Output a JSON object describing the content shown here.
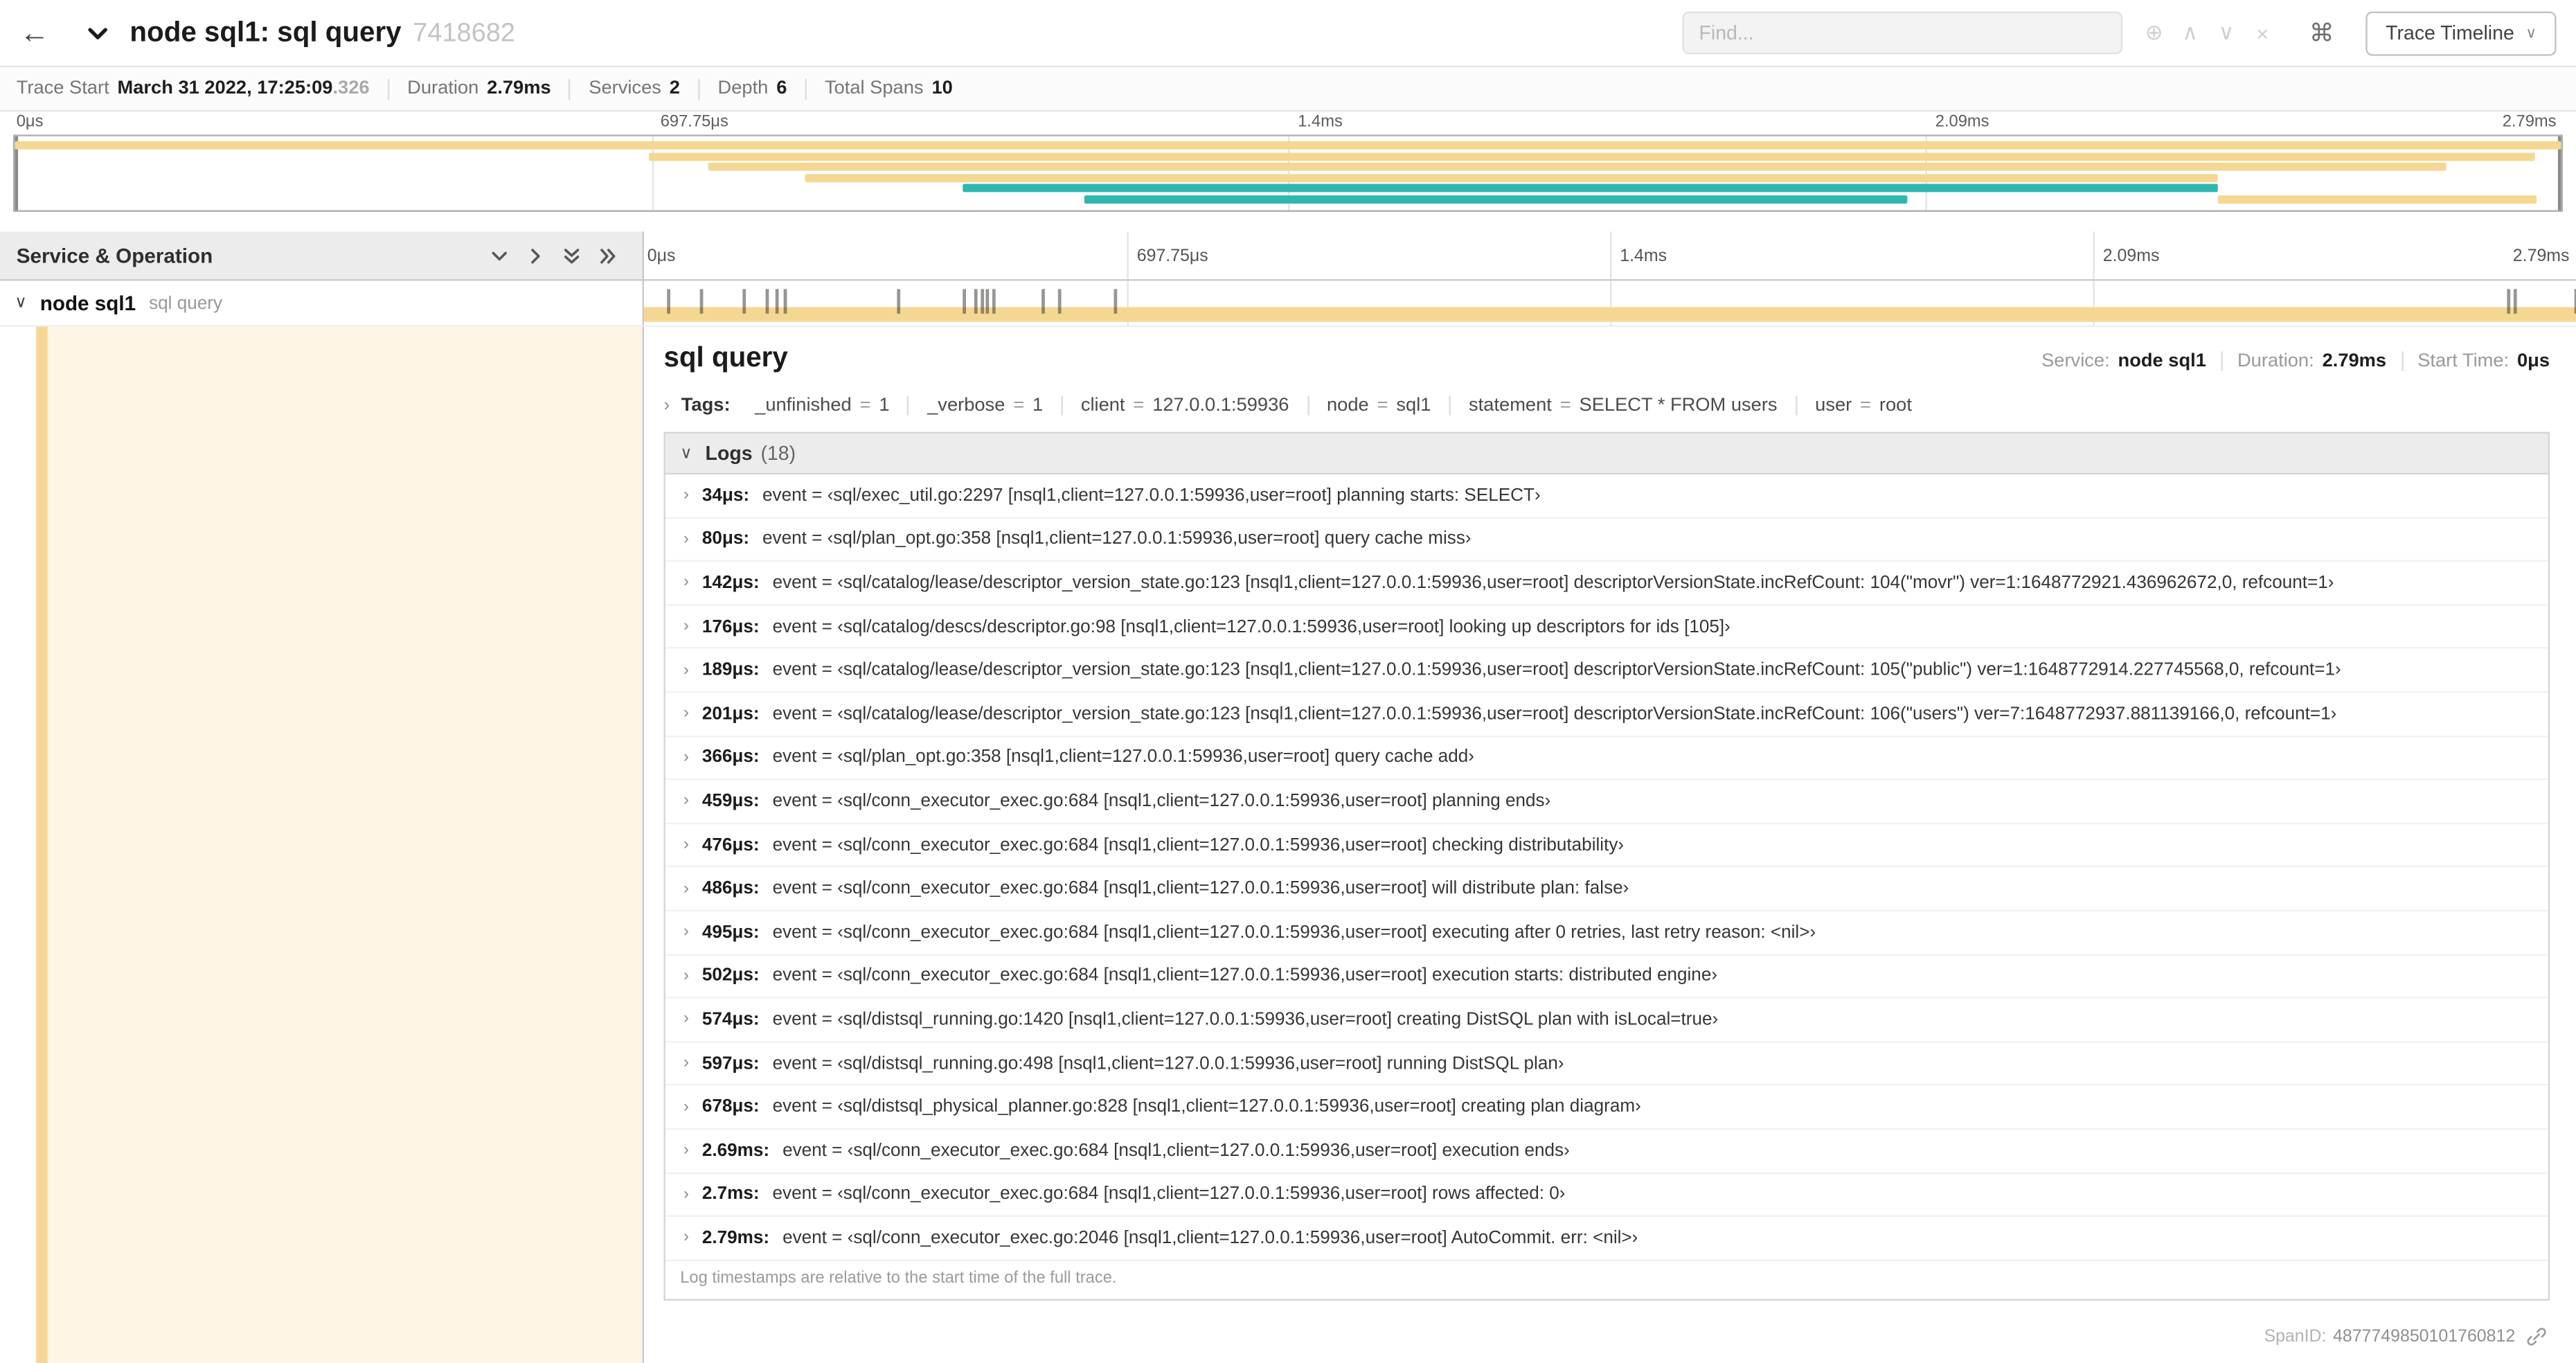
{
  "icons": {
    "back": "←",
    "chevron_down": "∨",
    "chevron_right": "›",
    "find_focus": "⊕",
    "find_prev": "∧",
    "find_next": "∨",
    "find_clear": "×",
    "command": "⌘"
  },
  "colors": {
    "span_tan": "#F5D794",
    "span_teal": "#2FB6B0",
    "detail_bg": "#FCF5E4"
  },
  "header": {
    "title": "node sql1: sql query",
    "trace_id": "7418682",
    "find_placeholder": "Find...",
    "view_menu_label": "Trace Timeline"
  },
  "trace_info": {
    "trace_start_label": "Trace Start",
    "trace_start_date": "March 31 2022, 17:25:09",
    "trace_start_frac": ".326",
    "duration_label": "Duration",
    "duration_value": "2.79ms",
    "services_label": "Services",
    "services_value": "2",
    "depth_label": "Depth",
    "depth_value": "6",
    "total_spans_label": "Total Spans",
    "total_spans_value": "10"
  },
  "minimap": {
    "ticks": [
      "0μs",
      "697.75μs",
      "1.4ms",
      "2.09ms",
      "2.79ms"
    ],
    "spans": [
      {
        "row": 0,
        "start": 0,
        "end": 100,
        "color": "tan"
      },
      {
        "row": 1,
        "start": 24.9,
        "end": 99,
        "color": "tan"
      },
      {
        "row": 2,
        "start": 27.2,
        "end": 95.5,
        "color": "tan"
      },
      {
        "row": 3,
        "start": 31,
        "end": 86.5,
        "color": "tan"
      },
      {
        "row": 4,
        "start": 37.2,
        "end": 86.5,
        "color": "teal"
      },
      {
        "row": 5,
        "start": 42,
        "end": 74.3,
        "color": "teal"
      },
      {
        "row": 5,
        "start": 86.5,
        "end": 99,
        "color": "tan"
      }
    ]
  },
  "timeline": {
    "left_header": "Service & Operation",
    "ticks": [
      "0μs",
      "697.75μs",
      "1.4ms",
      "2.09ms",
      "2.79ms"
    ]
  },
  "span_row": {
    "service": "node sql1",
    "operation": "sql query",
    "log_marker_pcts": [
      1.2,
      2.9,
      5.1,
      6.3,
      6.8,
      7.2,
      13.1,
      16.5,
      17.1,
      17.4,
      17.7,
      18.0,
      20.6,
      21.4,
      24.3,
      96.4,
      96.8,
      99.9
    ]
  },
  "detail": {
    "title": "sql query",
    "service_label": "Service:",
    "service_value": "node sql1",
    "duration_label": "Duration:",
    "duration_value": "2.79ms",
    "start_label": "Start Time:",
    "start_value": "0μs",
    "tags_label": "Tags:",
    "tag_separator": "=",
    "tags": [
      {
        "key": "_unfinished",
        "value": "1"
      },
      {
        "key": "_verbose",
        "value": "1"
      },
      {
        "key": "client",
        "value": "127.0.0.1:59936"
      },
      {
        "key": "node",
        "value": "sql1"
      },
      {
        "key": "statement",
        "value": "SELECT * FROM users"
      },
      {
        "key": "user",
        "value": "root"
      }
    ],
    "logs_label": "Logs",
    "logs_count_display": "(18)",
    "logs": [
      {
        "time": "34μs:",
        "message": "event = ‹sql/exec_util.go:2297 [nsql1,client=127.0.0.1:59936,user=root] planning starts: SELECT›"
      },
      {
        "time": "80μs:",
        "message": "event = ‹sql/plan_opt.go:358 [nsql1,client=127.0.0.1:59936,user=root] query cache miss›"
      },
      {
        "time": "142μs:",
        "message": "event = ‹sql/catalog/lease/descriptor_version_state.go:123 [nsql1,client=127.0.0.1:59936,user=root] descriptorVersionState.incRefCount: 104(\"movr\") ver=1:1648772921.436962672,0, refcount=1›"
      },
      {
        "time": "176μs:",
        "message": "event = ‹sql/catalog/descs/descriptor.go:98 [nsql1,client=127.0.0.1:59936,user=root] looking up descriptors for ids [105]›"
      },
      {
        "time": "189μs:",
        "message": "event = ‹sql/catalog/lease/descriptor_version_state.go:123 [nsql1,client=127.0.0.1:59936,user=root] descriptorVersionState.incRefCount: 105(\"public\") ver=1:1648772914.227745568,0, refcount=1›"
      },
      {
        "time": "201μs:",
        "message": "event = ‹sql/catalog/lease/descriptor_version_state.go:123 [nsql1,client=127.0.0.1:59936,user=root] descriptorVersionState.incRefCount: 106(\"users\") ver=7:1648772937.881139166,0, refcount=1›"
      },
      {
        "time": "366μs:",
        "message": "event = ‹sql/plan_opt.go:358 [nsql1,client=127.0.0.1:59936,user=root] query cache add›"
      },
      {
        "time": "459μs:",
        "message": "event = ‹sql/conn_executor_exec.go:684 [nsql1,client=127.0.0.1:59936,user=root] planning ends›"
      },
      {
        "time": "476μs:",
        "message": "event = ‹sql/conn_executor_exec.go:684 [nsql1,client=127.0.0.1:59936,user=root] checking distributability›"
      },
      {
        "time": "486μs:",
        "message": "event = ‹sql/conn_executor_exec.go:684 [nsql1,client=127.0.0.1:59936,user=root] will distribute plan: false›"
      },
      {
        "time": "495μs:",
        "message": "event = ‹sql/conn_executor_exec.go:684 [nsql1,client=127.0.0.1:59936,user=root] executing after 0 retries, last retry reason: <nil>›"
      },
      {
        "time": "502μs:",
        "message": "event = ‹sql/conn_executor_exec.go:684 [nsql1,client=127.0.0.1:59936,user=root] execution starts: distributed engine›"
      },
      {
        "time": "574μs:",
        "message": "event = ‹sql/distsql_running.go:1420 [nsql1,client=127.0.0.1:59936,user=root] creating DistSQL plan with isLocal=true›"
      },
      {
        "time": "597μs:",
        "message": "event = ‹sql/distsql_running.go:498 [nsql1,client=127.0.0.1:59936,user=root] running DistSQL plan›"
      },
      {
        "time": "678μs:",
        "message": "event = ‹sql/distsql_physical_planner.go:828 [nsql1,client=127.0.0.1:59936,user=root] creating plan diagram›"
      },
      {
        "time": "2.69ms:",
        "message": "event = ‹sql/conn_executor_exec.go:684 [nsql1,client=127.0.0.1:59936,user=root] execution ends›"
      },
      {
        "time": "2.7ms:",
        "message": "event = ‹sql/conn_executor_exec.go:684 [nsql1,client=127.0.0.1:59936,user=root] rows affected: 0›"
      },
      {
        "time": "2.79ms:",
        "message": "event = ‹sql/conn_executor_exec.go:2046 [nsql1,client=127.0.0.1:59936,user=root] AutoCommit. err: <nil>›"
      }
    ],
    "logs_footer": "Log timestamps are relative to the start time of the full trace.",
    "span_id_label": "SpanID:",
    "span_id_value": "4877749850101760812"
  }
}
